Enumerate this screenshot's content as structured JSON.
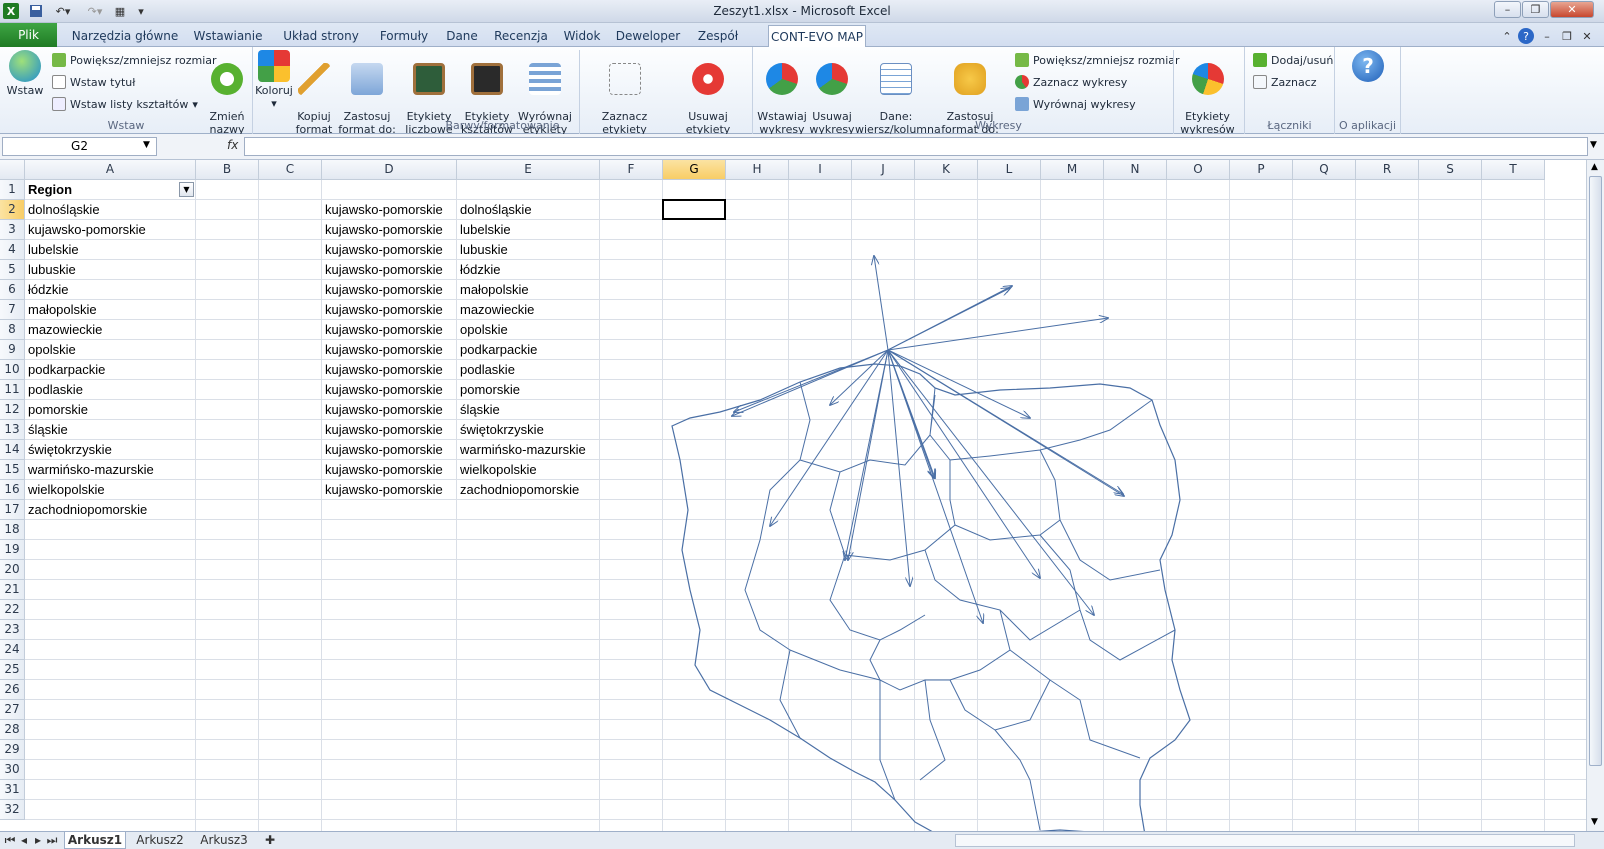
{
  "window": {
    "title": "Zeszyt1.xlsx - Microsoft Excel"
  },
  "qat": {
    "save_icon": "save-icon",
    "undo_icon": "undo-icon",
    "redo_icon": "redo-icon"
  },
  "tabs": [
    "Plik",
    "Narzędzia główne",
    "Wstawianie",
    "Układ strony",
    "Formuły",
    "Dane",
    "Recenzja",
    "Widok",
    "Deweloper",
    "Zespół",
    "CONT-EVO MAP"
  ],
  "ribbon": {
    "wstaw": {
      "big": "Wstaw",
      "resize": "Powiększ/zmniejsz rozmiar",
      "title": "Wstaw tytuł",
      "shapes": "Wstaw listy kształtów",
      "rename": "Zmień\nnazwy",
      "label": "Wstaw"
    },
    "barwy": {
      "koloruj": "Koloruj",
      "kopiuj": "Kopiuj\nformat",
      "zastosuj": "Zastosuj\nformat do:",
      "etyk_licz": "Etykiety\nliczbowe",
      "etyk_ksz": "Etykiety\nkształtów",
      "wyrownaj": "Wyrównaj\netykiety",
      "zaznacz": "Zaznacz etykiety\nlegendy",
      "usuwaj": "Usuwaj etykiety\nlegendy",
      "label": "Barwy/formatowanie"
    },
    "wykresy": {
      "wstawiaj": "Wstawiaj\nwykresy",
      "usuwaj": "Usuwaj\nwykresy",
      "dane": "Dane:\nwiersz/kolumna",
      "zastosuj": "Zastosuj\nformat do:",
      "resize": "Powiększ/zmniejsz rozmiar",
      "zaznacz": "Zaznacz wykresy",
      "wyrownaj": "Wyrównaj wykresy",
      "etykiety": "Etykiety\nwykresów",
      "label": "Wykresy"
    },
    "laczniki": {
      "dodaj": "Dodaj/usuń",
      "zaznacz": "Zaznacz",
      "label": "Łączniki"
    },
    "about": {
      "label": "O aplikacji"
    }
  },
  "namebox": "G2",
  "fx": "fx",
  "formula": "",
  "columns": [
    "A",
    "B",
    "C",
    "D",
    "E",
    "F",
    "G",
    "H",
    "I",
    "J",
    "K",
    "L",
    "M",
    "N",
    "O",
    "P",
    "Q",
    "R",
    "S",
    "T"
  ],
  "rows": [
    "1",
    "2",
    "3",
    "4",
    "5",
    "6",
    "7",
    "8",
    "9",
    "10",
    "11",
    "12",
    "13",
    "14",
    "15",
    "16",
    "17",
    "18",
    "19",
    "20",
    "21",
    "22",
    "23",
    "24",
    "25",
    "26",
    "27",
    "28",
    "29",
    "30",
    "31",
    "32"
  ],
  "colA": [
    "Region",
    "dolnośląskie",
    "kujawsko-pomorskie",
    "lubelskie",
    "lubuskie",
    "łódzkie",
    "małopolskie",
    "mazowieckie",
    "opolskie",
    "podkarpackie",
    "podlaskie",
    "pomorskie",
    "śląskie",
    "świętokrzyskie",
    "warmińsko-mazurskie",
    "wielkopolskie",
    "zachodniopomorskie"
  ],
  "colD": [
    "kujawsko-pomorskie",
    "kujawsko-pomorskie",
    "kujawsko-pomorskie",
    "kujawsko-pomorskie",
    "kujawsko-pomorskie",
    "kujawsko-pomorskie",
    "kujawsko-pomorskie",
    "kujawsko-pomorskie",
    "kujawsko-pomorskie",
    "kujawsko-pomorskie",
    "kujawsko-pomorskie",
    "kujawsko-pomorskie",
    "kujawsko-pomorskie",
    "kujawsko-pomorskie",
    "kujawsko-pomorskie"
  ],
  "colE": [
    "dolnośląskie",
    "lubelskie",
    "lubuskie",
    "łódzkie",
    "małopolskie",
    "mazowieckie",
    "opolskie",
    "podkarpackie",
    "podlaskie",
    "pomorskie",
    "śląskie",
    "świętokrzyskie",
    "warmińsko-mazurskie",
    "wielkopolskie",
    "zachodniopomorskie"
  ],
  "sheets": [
    "Arkusz1",
    "Arkusz2",
    "Arkusz3"
  ],
  "colors": {
    "excel_green": "#1f7b24",
    "map_line": "#4a6fa5",
    "selection": "#f8cd66"
  }
}
